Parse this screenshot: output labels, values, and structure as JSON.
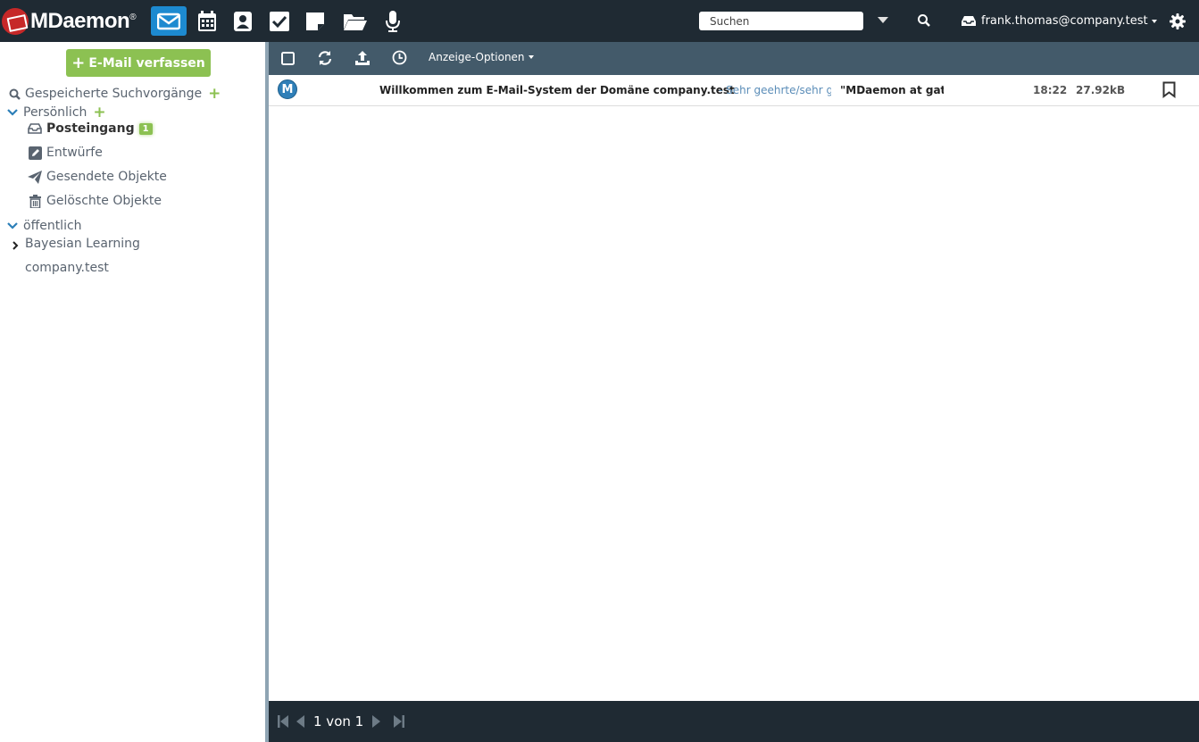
{
  "app": {
    "brand": "MDaemon",
    "brand_mark": "®"
  },
  "topbar": {
    "nav": [
      {
        "icon": "mail-icon",
        "active": true
      },
      {
        "icon": "calendar-icon",
        "active": false
      },
      {
        "icon": "contacts-icon",
        "active": false
      },
      {
        "icon": "tasks-icon",
        "active": false
      },
      {
        "icon": "notes-icon",
        "active": false
      },
      {
        "icon": "documents-icon",
        "active": false
      },
      {
        "icon": "microphone-icon",
        "active": false
      }
    ],
    "search_placeholder": "Suchen",
    "account": "frank.thomas@company.test"
  },
  "sidebar": {
    "compose_label": "E-Mail verfassen",
    "saved_searches": "Gespeicherte Suchvorgänge",
    "personal": "Persönlich",
    "inbox": "Posteingang",
    "inbox_unread": "1",
    "drafts": "Entwürfe",
    "sent": "Gesendete Objekte",
    "deleted": "Gelöschte Objekte",
    "public": "öffentlich",
    "bayesian": "Bayesian Learning",
    "domain": "company.test"
  },
  "toolbar": {
    "view_options": "Anzeige-Optionen"
  },
  "messages": [
    {
      "avatar": "M",
      "subject": "Willkommen zum E-Mail-System der Domäne company.test",
      "preview": " - Sehr geehrte/sehr geehrter",
      "from": "\"MDaemon at gateway\"",
      "time": "18:22",
      "size": "27.92kB"
    }
  ],
  "pager": {
    "text": "1 von 1"
  },
  "colors": {
    "topbar": "#1f2a33",
    "accent": "#1d8ad0",
    "compose": "#8cc152",
    "toolbar": "#435a6a"
  }
}
